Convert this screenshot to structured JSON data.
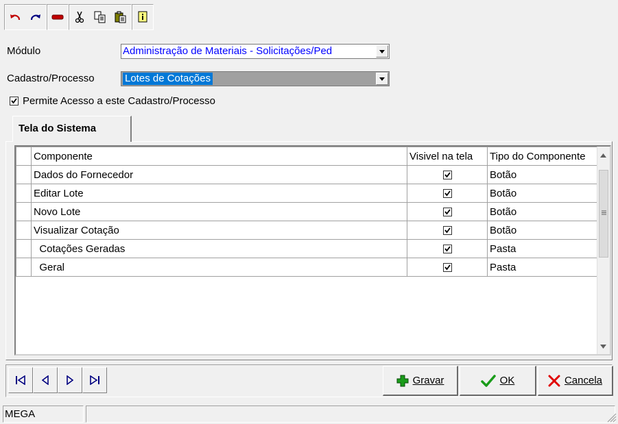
{
  "toolbar": {
    "icons": [
      "undo-icon",
      "redo-icon",
      "delete-icon",
      "cut-icon",
      "copy-icon",
      "paste-icon",
      "info-icon"
    ]
  },
  "form": {
    "modulo_label": "Módulo",
    "modulo_value": "Administração de Materiais - Solicitações/Ped",
    "cadastro_label": "Cadastro/Processo",
    "cadastro_value": "Lotes de Cotações",
    "permite_label": "Permite Acesso a este Cadastro/Processo",
    "permite_checked": true
  },
  "tab": {
    "label": "Tela do Sistema"
  },
  "grid": {
    "headers": [
      "Componente",
      "Visivel na tela",
      "Tipo do Componente"
    ],
    "rows": [
      {
        "componente": "Dados do Fornecedor",
        "visivel": true,
        "tipo": "Botão"
      },
      {
        "componente": "Editar Lote",
        "visivel": true,
        "tipo": "Botão"
      },
      {
        "componente": "Novo Lote",
        "visivel": true,
        "tipo": "Botão"
      },
      {
        "componente": "Visualizar Cotação",
        "visivel": true,
        "tipo": "Botão"
      },
      {
        "componente": "  Cotações Geradas",
        "visivel": true,
        "tipo": "Pasta"
      },
      {
        "componente": "  Geral",
        "visivel": true,
        "tipo": "Pasta"
      }
    ]
  },
  "buttons": {
    "gravar": "Gravar",
    "ok": "OK",
    "cancela": "Cancela"
  },
  "status": {
    "panel1": "MEGA"
  },
  "colors": {
    "selection": "#0078d7",
    "blue_text": "#0000ff",
    "red_icon": "#c00000",
    "green_icon": "#1a9c1a",
    "navy_icon": "#000080"
  }
}
